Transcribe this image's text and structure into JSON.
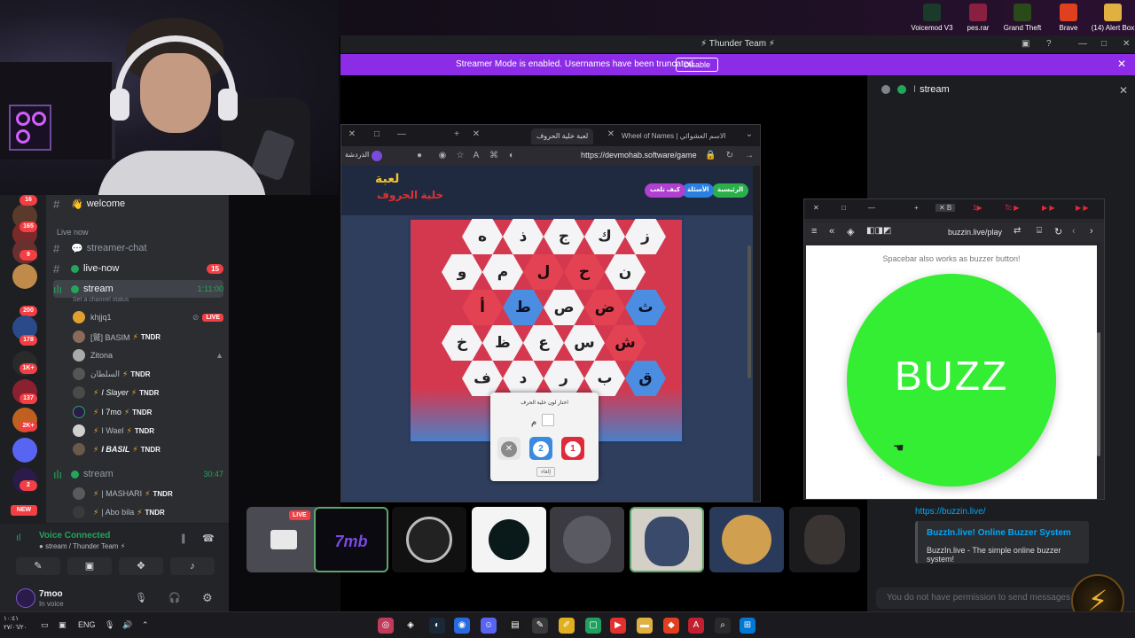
{
  "desktop": {
    "icons": [
      {
        "label": "Voicemod V3",
        "color": "#1a3a2a"
      },
      {
        "label": "pes.rar",
        "color": "#8a2040"
      },
      {
        "label": "Grand Theft",
        "color": "#2a4a1a"
      },
      {
        "label": "Brave",
        "color": "#e04020"
      },
      {
        "label": "(14) Alert Box",
        "color": "#e0b040"
      }
    ]
  },
  "discord": {
    "window_title": "Thunder Team",
    "streamer_mode": {
      "message": "Streamer Mode is enabled. Usernames have been truncated.",
      "disable_label": "Disable"
    },
    "guild_badges": [
      "16",
      "165",
      "9",
      "200",
      "178",
      "1K+",
      "137",
      "2K+",
      "2"
    ],
    "new_label": "NEW",
    "channels": {
      "welcome": "welcome",
      "section_live_now": "Live now",
      "streamer_chat": "streamer-chat",
      "live_now": "live-now",
      "live_now_badge": "15",
      "stream": "stream",
      "stream_time": "1:11:00",
      "set_status": "Set a channel status",
      "stream2": "stream",
      "stream2_time": "30:47"
    },
    "voice_users": [
      {
        "name": "khjjq1",
        "tag": "",
        "live": "LIVE"
      },
      {
        "name": "[鷲] BASIM",
        "tag": "TNDR"
      },
      {
        "name": "Zitona",
        "tag": ""
      },
      {
        "name": "السلطان",
        "tag": "TNDR"
      },
      {
        "name": "I Slayer",
        "tag": "TNDR"
      },
      {
        "name": "I 7mo",
        "tag": "TNDR"
      },
      {
        "name": "I Wael",
        "tag": "TNDR"
      },
      {
        "name": "I BASIL",
        "tag": "TNDR"
      }
    ],
    "voice_users2": [
      {
        "name": "| MASHARI",
        "tag": "TNDR"
      },
      {
        "name": "| Abo bila",
        "tag": "TNDR"
      }
    ],
    "voice_panel": {
      "title": "Voice Connected",
      "subtitle": "stream / Thunder Team"
    },
    "user": {
      "name": "7moo",
      "status": "In voice"
    },
    "right_panel": {
      "title": "stream",
      "link": "https://buzzin.live/",
      "embed_title": "BuzzIn.live! Online Buzzer System",
      "embed_desc": "BuzzIn.live - The simple online buzzer system!",
      "no_permission": "You do not have permission to send messages"
    }
  },
  "game_browser": {
    "tab1": "لعبة خلية الحروف",
    "tab2": "Wheel of Names | الاسم العشوائي",
    "profile": "الدردشة",
    "url": "https://devmohab.software/game",
    "logo_line1": "لعبة",
    "logo_line2": "خلية الحروف",
    "buttons": [
      "الرئيسية",
      "الأسئلة",
      "كيف تلعب"
    ],
    "hex_rows": [
      [
        "ز",
        "ك",
        "ج",
        "ذ",
        "ه"
      ],
      [
        "ن",
        "ح",
        "ل",
        "م",
        "و"
      ],
      [
        "ث",
        "ض",
        "ص",
        "ط",
        "أ"
      ],
      [
        "ش",
        "س",
        "ع",
        "ظ",
        "خ"
      ],
      [
        "ق",
        "ب",
        "ر",
        "د",
        "ف"
      ]
    ],
    "popup": {
      "title": "اختار لون خلية الحرف",
      "letter": "م",
      "buttons": [
        "2",
        "1"
      ],
      "ok": "إلغاء"
    }
  },
  "buzzin": {
    "url": "buzzin.live/play",
    "hint": "Spacebar also works as buzzer button!",
    "button": "BUZZ"
  },
  "tiles": {
    "live": "LIVE",
    "items": [
      "7mb"
    ]
  },
  "taskbar": {
    "clock_line1": "١٠:٤١",
    "clock_line2": "٢٧/٠٦/٢٠",
    "lang": "ENG"
  }
}
